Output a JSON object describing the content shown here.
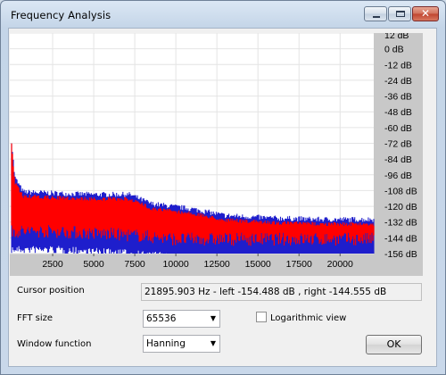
{
  "window": {
    "title": "Frequency Analysis"
  },
  "titlebar_controls": [
    "minimize-button",
    "maximize-button",
    "close-button"
  ],
  "chart_data": {
    "type": "area",
    "series": [
      {
        "color": "#ff0000"
      },
      {
        "color": "#1e1ecc"
      }
    ],
    "xlim": [
      0,
      22050
    ],
    "x_ticks": [
      "2500",
      "5000",
      "7500",
      "10000",
      "12500",
      "15000",
      "17500",
      "20000"
    ],
    "x_tick_values": [
      2500,
      5000,
      7500,
      10000,
      12500,
      15000,
      17500,
      20000
    ],
    "ylim": [
      -156,
      12
    ],
    "y_ticks": [
      "12 dB",
      "0 dB",
      "-12 dB",
      "-24 dB",
      "-36 dB",
      "-48 dB",
      "-60 dB",
      "-72 dB",
      "-84 dB",
      "-96 dB",
      "-108 dB",
      "-120 dB",
      "-132 dB",
      "-144 dB",
      "-156 dB"
    ],
    "y_tick_values": [
      12,
      0,
      -12,
      -24,
      -36,
      -48,
      -60,
      -72,
      -84,
      -96,
      -108,
      -120,
      -132,
      -144,
      -156
    ],
    "grid": true,
    "envelope_top_db": [
      {
        "x": 0,
        "y": -72
      },
      {
        "x": 200,
        "y": -100
      },
      {
        "x": 700,
        "y": -111
      },
      {
        "x": 2500,
        "y": -112
      },
      {
        "x": 5000,
        "y": -113
      },
      {
        "x": 7200,
        "y": -113
      },
      {
        "x": 8500,
        "y": -120
      },
      {
        "x": 11000,
        "y": -124
      },
      {
        "x": 13000,
        "y": -129
      },
      {
        "x": 16000,
        "y": -131
      },
      {
        "x": 19000,
        "y": -132
      },
      {
        "x": 22050,
        "y": -132
      }
    ],
    "envelope_bottom_db": [
      {
        "x": 0,
        "y": -150
      },
      {
        "x": 2500,
        "y": -150
      },
      {
        "x": 7500,
        "y": -153
      },
      {
        "x": 10000,
        "y": -156
      },
      {
        "x": 22050,
        "y": -156
      }
    ]
  },
  "cursor": {
    "label": "Cursor position",
    "value": "21895.903 Hz  -  left -154.488 dB , right -144.555 dB"
  },
  "fft_size": {
    "label": "FFT size",
    "value": "65536"
  },
  "window_function": {
    "label": "Window function",
    "value": "Hanning"
  },
  "log_view": {
    "label": "Logarithmic view",
    "checked": false
  },
  "ok_button": {
    "label": "OK"
  }
}
